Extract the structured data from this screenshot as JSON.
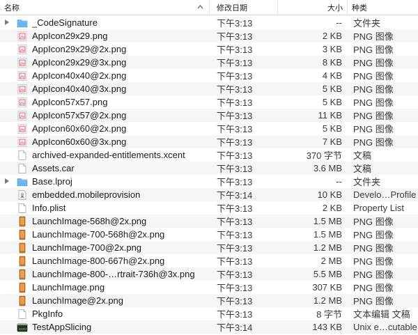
{
  "columns": {
    "name": "名称",
    "date": "修改日期",
    "size": "大小",
    "kind": "种类"
  },
  "files": [
    {
      "name": "_CodeSignature",
      "date": "下午3:13",
      "size": "--",
      "kind": "文件夹",
      "icon": "folder-icon",
      "expandable": true
    },
    {
      "name": "AppIcon29x29.png",
      "date": "下午3:13",
      "size": "2 KB",
      "kind": "PNG 图像",
      "icon": "png-icon",
      "expandable": false
    },
    {
      "name": "AppIcon29x29@2x.png",
      "date": "下午3:13",
      "size": "3 KB",
      "kind": "PNG 图像",
      "icon": "png-icon",
      "expandable": false
    },
    {
      "name": "AppIcon29x29@3x.png",
      "date": "下午3:13",
      "size": "8 KB",
      "kind": "PNG 图像",
      "icon": "png-icon",
      "expandable": false
    },
    {
      "name": "AppIcon40x40@2x.png",
      "date": "下午3:13",
      "size": "4 KB",
      "kind": "PNG 图像",
      "icon": "png-icon",
      "expandable": false
    },
    {
      "name": "AppIcon40x40@3x.png",
      "date": "下午3:13",
      "size": "5 KB",
      "kind": "PNG 图像",
      "icon": "png-icon",
      "expandable": false
    },
    {
      "name": "AppIcon57x57.png",
      "date": "下午3:13",
      "size": "5 KB",
      "kind": "PNG 图像",
      "icon": "png-icon",
      "expandable": false
    },
    {
      "name": "AppIcon57x57@2x.png",
      "date": "下午3:13",
      "size": "11 KB",
      "kind": "PNG 图像",
      "icon": "png-icon",
      "expandable": false
    },
    {
      "name": "AppIcon60x60@2x.png",
      "date": "下午3:13",
      "size": "5 KB",
      "kind": "PNG 图像",
      "icon": "png-icon",
      "expandable": false
    },
    {
      "name": "AppIcon60x60@3x.png",
      "date": "下午3:13",
      "size": "7 KB",
      "kind": "PNG 图像",
      "icon": "png-icon",
      "expandable": false
    },
    {
      "name": "archived-expanded-entitlements.xcent",
      "date": "下午3:13",
      "size": "370 字节",
      "kind": "文稿",
      "icon": "document-icon",
      "expandable": false
    },
    {
      "name": "Assets.car",
      "date": "下午3:13",
      "size": "3.6 MB",
      "kind": "文稿",
      "icon": "document-icon",
      "expandable": false
    },
    {
      "name": "Base.lproj",
      "date": "下午3:13",
      "size": "--",
      "kind": "文件夹",
      "icon": "folder-icon",
      "expandable": true
    },
    {
      "name": "embedded.mobileprovision",
      "date": "下午3:14",
      "size": "10 KB",
      "kind": "Develo…Profile",
      "icon": "provision-icon",
      "expandable": false
    },
    {
      "name": "Info.plist",
      "date": "下午3:13",
      "size": "2 KB",
      "kind": "Property List",
      "icon": "document-icon",
      "expandable": false
    },
    {
      "name": "LaunchImage-568h@2x.png",
      "date": "下午3:13",
      "size": "1.5 MB",
      "kind": "PNG 图像",
      "icon": "launch-image-icon",
      "expandable": false
    },
    {
      "name": "LaunchImage-700-568h@2x.png",
      "date": "下午3:13",
      "size": "1.5 MB",
      "kind": "PNG 图像",
      "icon": "launch-image-icon",
      "expandable": false
    },
    {
      "name": "LaunchImage-700@2x.png",
      "date": "下午3:13",
      "size": "1.2 MB",
      "kind": "PNG 图像",
      "icon": "launch-image-icon",
      "expandable": false
    },
    {
      "name": "LaunchImage-800-667h@2x.png",
      "date": "下午3:13",
      "size": "2 MB",
      "kind": "PNG 图像",
      "icon": "launch-image-icon",
      "expandable": false
    },
    {
      "name": "LaunchImage-800-…rtrait-736h@3x.png",
      "date": "下午3:13",
      "size": "5.5 MB",
      "kind": "PNG 图像",
      "icon": "launch-image-icon",
      "expandable": false
    },
    {
      "name": "LaunchImage.png",
      "date": "下午3:13",
      "size": "307 KB",
      "kind": "PNG 图像",
      "icon": "launch-image-icon",
      "expandable": false
    },
    {
      "name": "LaunchImage@2x.png",
      "date": "下午3:13",
      "size": "1.2 MB",
      "kind": "PNG 图像",
      "icon": "launch-image-icon",
      "expandable": false
    },
    {
      "name": "PkgInfo",
      "date": "下午3:13",
      "size": "8 字节",
      "kind": "文本编辑 文稿",
      "icon": "document-icon",
      "expandable": false
    },
    {
      "name": "TestAppSlicing",
      "date": "下午3:14",
      "size": "143 KB",
      "kind": "Unix e…cutable",
      "icon": "executable-icon",
      "expandable": false
    }
  ],
  "colors": {
    "folder": "#6ab6f0",
    "png_border": "#d96a6a",
    "launch_image": "#c8782a",
    "row_stripe": "#f4f5f5"
  }
}
